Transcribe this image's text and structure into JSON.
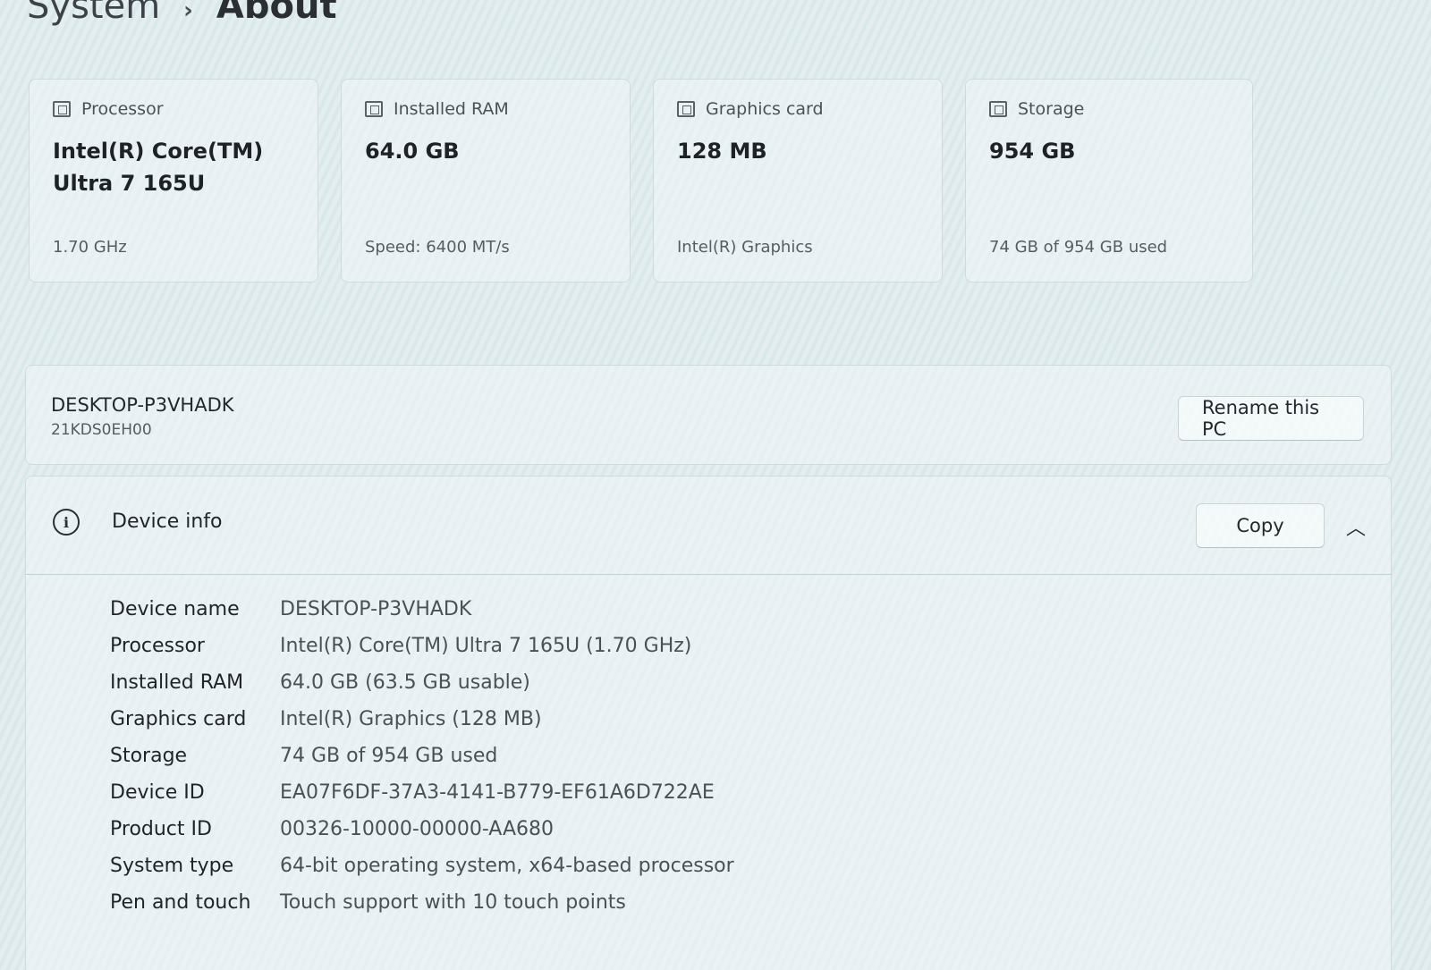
{
  "breadcrumb": {
    "parent": "System",
    "separator": "›",
    "current": "About"
  },
  "cards": [
    {
      "label": "Processor",
      "icon": "processor-icon",
      "value": "Intel(R) Core(TM) Ultra 7 165U",
      "sub": "1.70 GHz"
    },
    {
      "label": "Installed RAM",
      "icon": "ram-icon",
      "value": "64.0 GB",
      "sub": "Speed: 6400 MT/s"
    },
    {
      "label": "Graphics card",
      "icon": "graphics-card-icon",
      "value": "128 MB",
      "sub": "Intel(R) Graphics"
    },
    {
      "label": "Storage",
      "icon": "storage-icon",
      "value": "954 GB",
      "sub": "74 GB of 954 GB used"
    }
  ],
  "pc": {
    "name": "DESKTOP-P3VHADK",
    "model": "21KDS0EH00",
    "rename_label": "Rename this PC"
  },
  "device_info": {
    "title": "Device info",
    "copy_label": "Copy",
    "chevron": "^",
    "rows": [
      {
        "key": "Device name",
        "value": "DESKTOP-P3VHADK"
      },
      {
        "key": "Processor",
        "value": "Intel(R) Core(TM) Ultra 7 165U (1.70 GHz)"
      },
      {
        "key": "Installed RAM",
        "value": "64.0 GB (63.5 GB usable)"
      },
      {
        "key": "Graphics card",
        "value": "Intel(R) Graphics (128 MB)"
      },
      {
        "key": "Storage",
        "value": "74 GB of 954 GB used"
      },
      {
        "key": "Device ID",
        "value": "EA07F6DF-37A3-4141-B779-EF61A6D722AE"
      },
      {
        "key": "Product ID",
        "value": "00326-10000-00000-AA680"
      },
      {
        "key": "System type",
        "value": "64-bit operating system, x64-based processor"
      },
      {
        "key": "Pen and touch",
        "value": "Touch support with 10 touch points"
      }
    ]
  }
}
